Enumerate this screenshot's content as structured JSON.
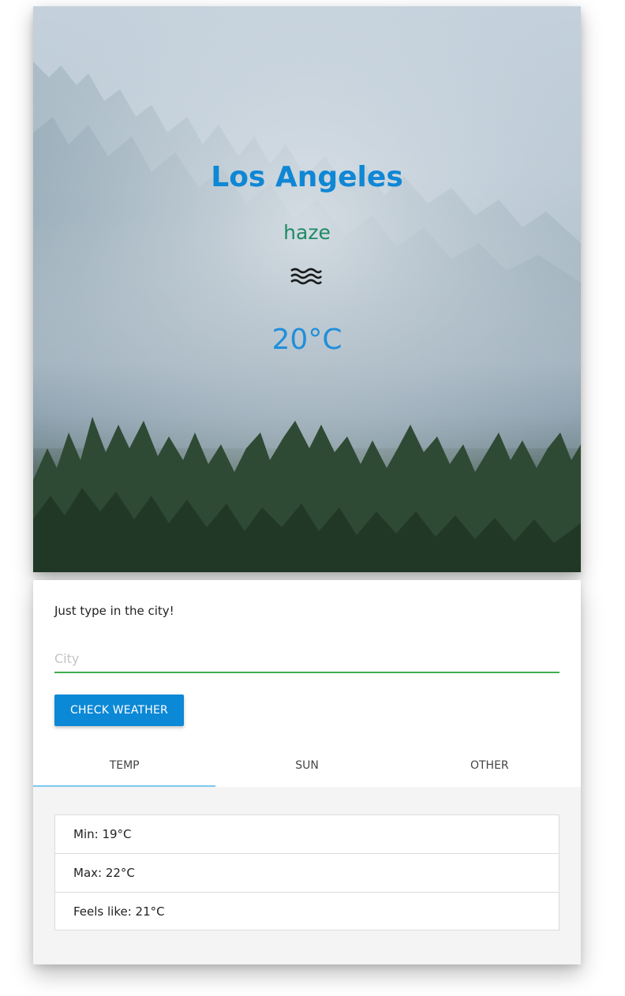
{
  "hero": {
    "city": "Los Angeles",
    "condition": "haze",
    "condition_icon": "haze-icon",
    "temperature": "20°C",
    "colors": {
      "city": "#0f87d4",
      "condition": "#1e8a66",
      "temperature": "#1f8fdb"
    }
  },
  "search": {
    "hint": "Just type in the city!",
    "placeholder": "City",
    "value": "",
    "button_label": "CHECK WEATHER",
    "underline_color": "#3eae50",
    "button_color": "#0b88d6"
  },
  "tabs": [
    {
      "label": "TEMP",
      "active": true
    },
    {
      "label": "SUN",
      "active": false
    },
    {
      "label": "OTHER",
      "active": false
    }
  ],
  "temp_details": [
    {
      "text": "Min: 19°C"
    },
    {
      "text": "Max: 22°C"
    },
    {
      "text": "Feels like: 21°C"
    }
  ]
}
